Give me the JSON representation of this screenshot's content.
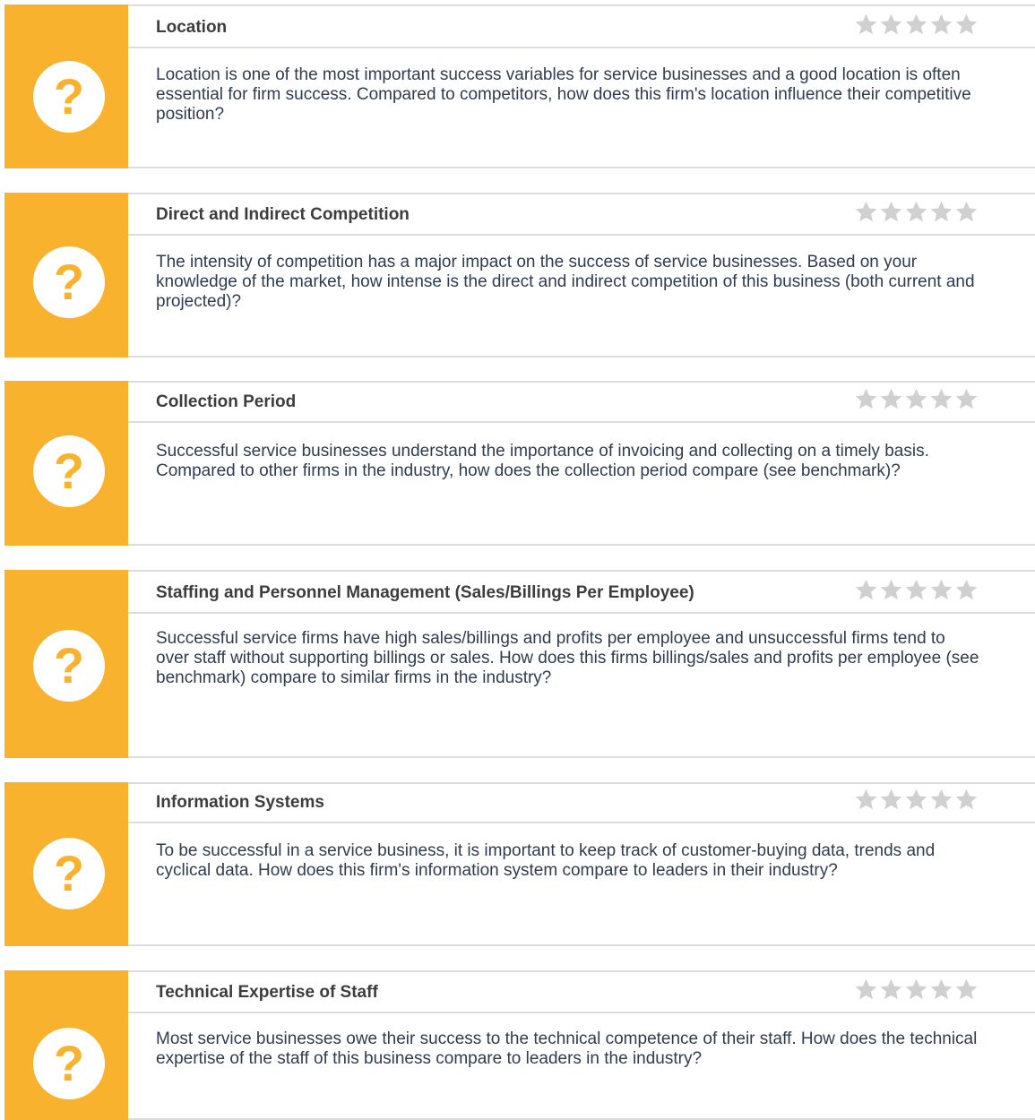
{
  "colors": {
    "accent": "#F9B22D",
    "divider": "#DCDCDC",
    "star": "#D0D0D0",
    "question_mark": "#F9B22D"
  },
  "icons": {
    "card_icon": "question-mark-icon",
    "rating_icon": "star-icon"
  },
  "question_mark": "?",
  "rating_max": 5,
  "cards": [
    {
      "title": "Location",
      "description": "Location is one of the most important success variables for service businesses and a good location is often essential for firm success. Compared to competitors, how does this firm's location influence their competitive position?",
      "rating": 0
    },
    {
      "title": "Direct and Indirect Competition",
      "description": "The intensity of competition has a major impact on the success of service businesses. Based on your knowledge of the market, how intense is the direct and indirect competition of this business (both current and projected)?",
      "rating": 0
    },
    {
      "title": "Collection Period",
      "description": "Successful service businesses understand the importance of invoicing and collecting on a timely basis. Compared to other firms in the industry, how does the collection period compare (see benchmark)?",
      "rating": 0
    },
    {
      "title": "Staffing and Personnel Management (Sales/Billings Per Employee)",
      "description": "Successful service firms have high sales/billings and profits per employee and unsuccessful firms tend to over staff without supporting billings or sales. How does this firms billings/sales and profits per employee (see benchmark) compare to similar firms in the industry?",
      "rating": 0
    },
    {
      "title": "Information Systems",
      "description": "To be successful in a service business, it is important to keep track of customer-buying data, trends and cyclical data. How does this firm's information system compare to leaders in their industry?",
      "rating": 0
    },
    {
      "title": "Technical Expertise of Staff",
      "description": "Most service businesses owe their success to the technical competence of their staff. How does the technical expertise of the staff of this business compare to leaders in the industry?",
      "rating": 0
    }
  ]
}
